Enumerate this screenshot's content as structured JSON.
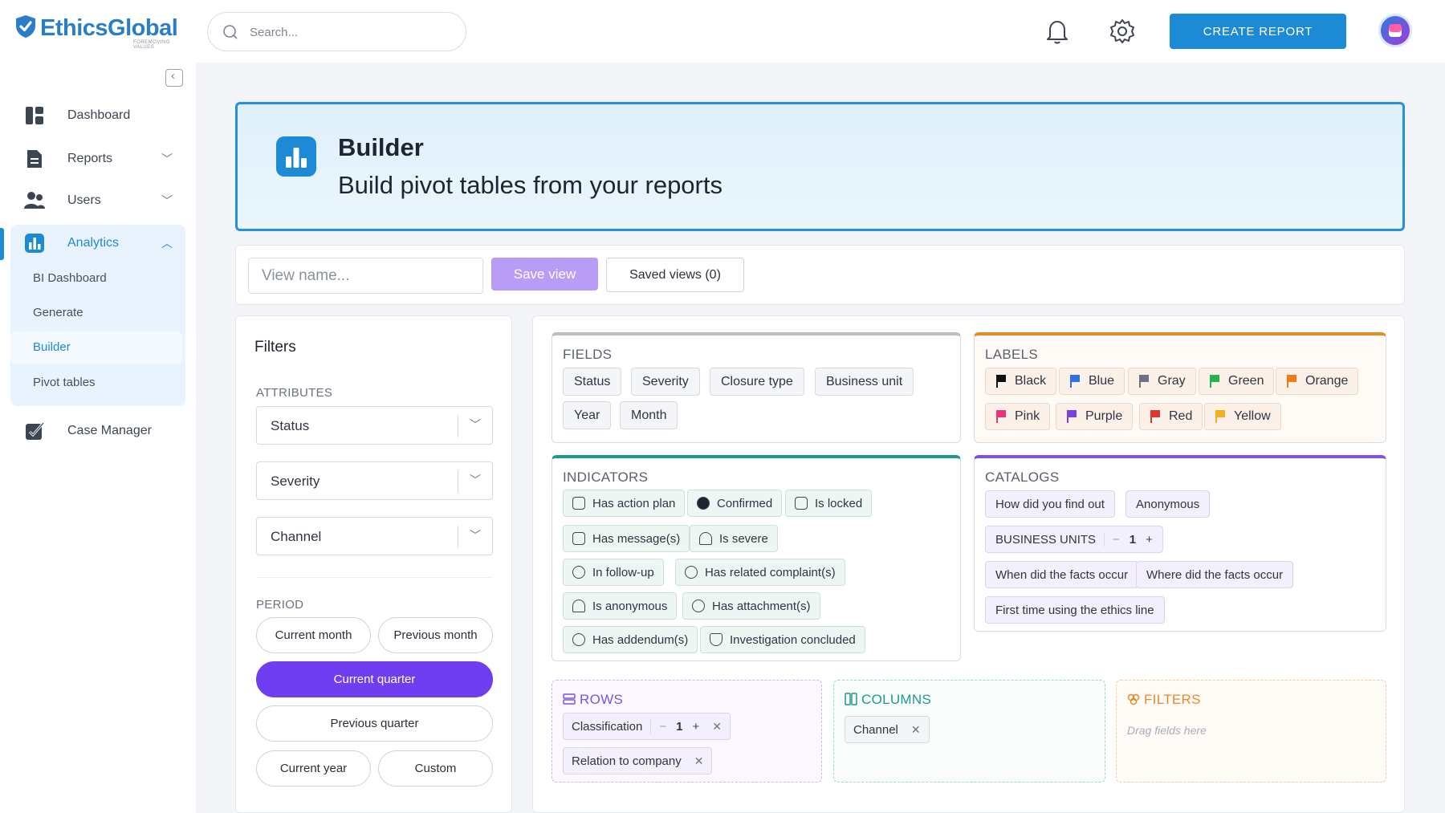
{
  "brand": {
    "name": "EthicsGlobal",
    "tagline": "FOREMOVING VALUES"
  },
  "search": {
    "placeholder": "Search..."
  },
  "header": {
    "create_report": "CREATE REPORT"
  },
  "sidebar": {
    "items": [
      {
        "label": "Dashboard",
        "icon": "dashboard-icon"
      },
      {
        "label": "Reports",
        "icon": "reports-icon"
      },
      {
        "label": "Users",
        "icon": "users-icon"
      },
      {
        "label": "Analytics",
        "icon": "analytics-icon"
      },
      {
        "label": "Case Manager",
        "icon": "case-manager-icon"
      }
    ],
    "analytics_sub": [
      "BI Dashboard",
      "Generate",
      "Builder",
      "Pivot tables"
    ]
  },
  "hero": {
    "title": "Builder",
    "subtitle": "Build pivot tables from your reports"
  },
  "viewbar": {
    "placeholder": "View name...",
    "save": "Save view",
    "saved": "Saved views (0)"
  },
  "filters": {
    "title": "Filters",
    "attributes_label": "ATTRIBUTES",
    "selects": [
      "Status",
      "Severity",
      "Channel"
    ],
    "period_label": "PERIOD",
    "periods": [
      "Current month",
      "Previous month",
      "Current quarter",
      "Previous quarter",
      "Current year",
      "Custom"
    ],
    "active_period": "Current quarter"
  },
  "fields": {
    "title": "FIELDS",
    "items": [
      "Status",
      "Severity",
      "Closure type",
      "Business unit",
      "Year",
      "Month"
    ]
  },
  "labels": {
    "title": "LABELS",
    "items": [
      {
        "name": "Black",
        "color": "#111111"
      },
      {
        "name": "Blue",
        "color": "#2f6fe8"
      },
      {
        "name": "Gray",
        "color": "#6b7280"
      },
      {
        "name": "Green",
        "color": "#22b34a"
      },
      {
        "name": "Orange",
        "color": "#f07a1a"
      },
      {
        "name": "Pink",
        "color": "#e8357a"
      },
      {
        "name": "Purple",
        "color": "#7b3fe4"
      },
      {
        "name": "Red",
        "color": "#e0342c"
      },
      {
        "name": "Yellow",
        "color": "#f2b01e"
      }
    ]
  },
  "indicators": {
    "title": "INDICATORS",
    "items": [
      "Has action plan",
      "Confirmed",
      "Is locked",
      "Has message(s)",
      "Is severe",
      "In follow-up",
      "Has related complaint(s)",
      "Is anonymous",
      "Has attachment(s)",
      "Has addendum(s)",
      "Investigation concluded"
    ]
  },
  "catalogs": {
    "title": "CATALOGS",
    "items": [
      "How did you find out",
      "Anonymous",
      "BUSINESS UNITS",
      "When did the facts occur",
      "Where did the facts occur",
      "First time using the ethics line"
    ],
    "business_units_value": "1"
  },
  "rows": {
    "title": "ROWS",
    "items": [
      {
        "name": "Classification",
        "value": "1"
      },
      {
        "name": "Relation to company"
      }
    ]
  },
  "columns": {
    "title": "COLUMNS",
    "items": [
      "Channel"
    ]
  },
  "drop_filters": {
    "title": "FILTERS",
    "placeholder": "Drag fields here"
  },
  "colors": {
    "accent": "#1d8ad6",
    "purple": "#6f3ef0",
    "fields_border": "#b8bdc6",
    "labels_border": "#e88a2c",
    "indicators_border": "#1e9a8a",
    "catalogs_border": "#7b52e8"
  }
}
